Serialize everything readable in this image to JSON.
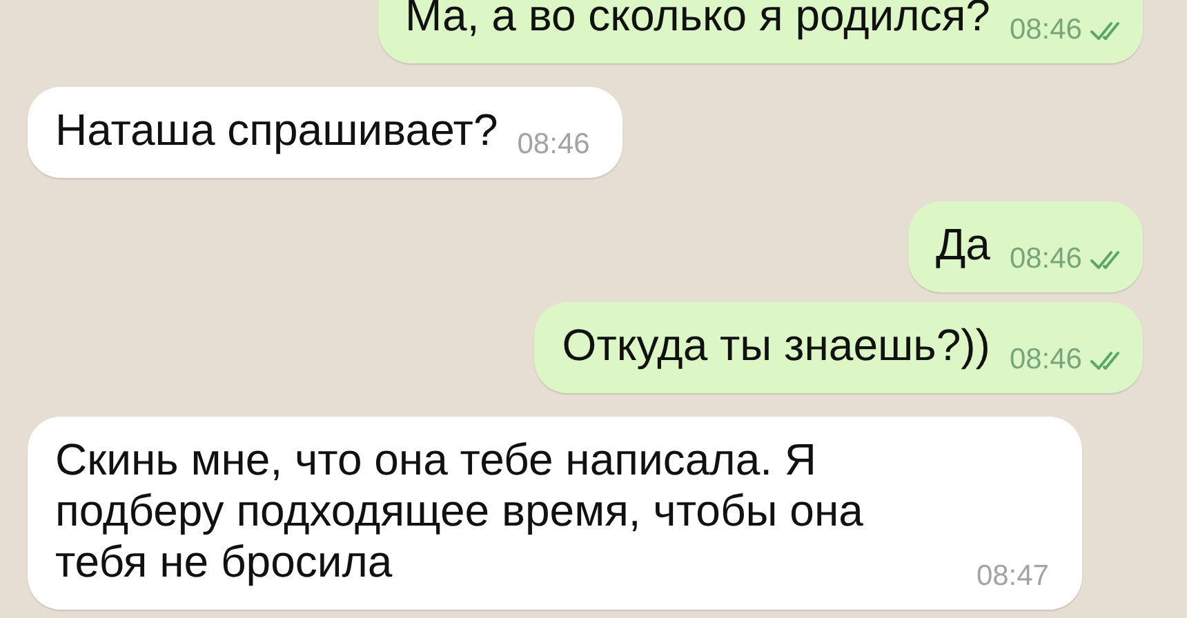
{
  "messages": [
    {
      "kind": "outgoing",
      "text": "Ма, а во сколько я родился?",
      "time": "08:46",
      "read": true
    },
    {
      "kind": "incoming",
      "text": "Наташа спрашивает?",
      "time": "08:46"
    },
    {
      "kind": "outgoing",
      "text": "Да",
      "time": "08:46",
      "read": true
    },
    {
      "kind": "outgoing",
      "text": "Откуда ты знаешь?))",
      "time": "08:46",
      "read": true
    },
    {
      "kind": "incoming",
      "text": "Скинь мне, что она тебе написала. Я подберу подходящее время, чтобы она тебя не бросила",
      "time": "08:47"
    }
  ]
}
